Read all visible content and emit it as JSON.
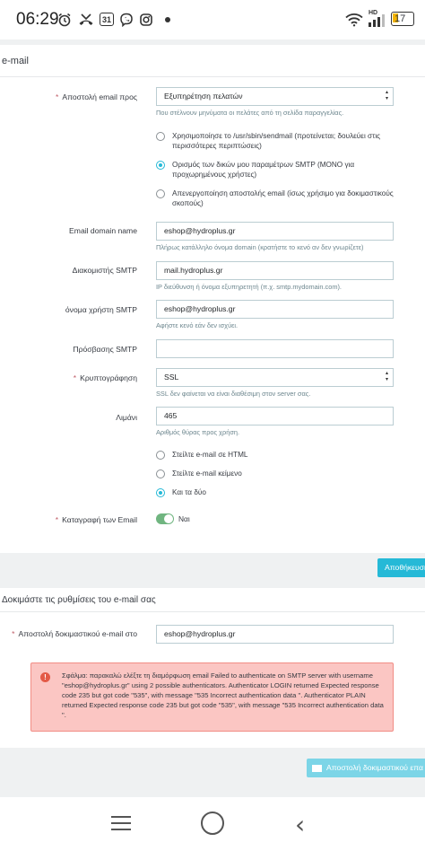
{
  "status_bar": {
    "time": "06:29",
    "icons": [
      "alarm-icon",
      "missed-call-icon",
      "calendar-icon",
      "viber-icon",
      "instagram-icon",
      "dot-icon",
      "wifi-icon",
      "signal-icon",
      "battery-icon"
    ],
    "calendar_day": "31",
    "network": "HD",
    "battery": "17"
  },
  "email_section": {
    "title": "e-mail",
    "send_to": {
      "label": "Αποστολή email προς",
      "value": "Εξυπηρέτηση πελατών",
      "help": "Που στέλνουν μηνύματα οι πελάτες από τη σελίδα παραγγελίας."
    },
    "transport_options": [
      {
        "label": "Χρησιμοποίησε το /usr/sbin/sendmail (προτείνεται; δουλεύει στις περισσότερες περιπτώσεις)",
        "selected": false
      },
      {
        "label": "Ορισμός των δικών μου παραμέτρων SMTP (ΜΟΝΟ για προχωρημένους χρήστες)",
        "selected": true
      },
      {
        "label": "Απενεργοποίηση αποστολής email (ίσως χρήσιμο για δοκιμαστικούς σκοπούς)",
        "selected": false
      }
    ],
    "domain": {
      "label": "Email domain name",
      "value": "eshop@hydroplus.gr",
      "help": "Πλήρως κατάλληλο όνομα domain (κρατήστε το κενό αν δεν γνωρίζετε)"
    },
    "smtp_server": {
      "label": "Διακομιστής SMTP",
      "value": "mail.hydroplus.gr",
      "help": "IP διεύθυνση ή όνομα εξυπηρετητή (π.χ. smtp.mydomain.com)."
    },
    "smtp_user": {
      "label": "όνομα χρήστη SMTP",
      "value": "eshop@hydroplus.gr",
      "help": "Αφήστε κενό εάν δεν ισχύει."
    },
    "smtp_password": {
      "label": "Πρόσβασης SMTP",
      "value": ""
    },
    "encryption": {
      "label": "Κρυπτογράφηση",
      "value": "SSL",
      "help": "SSL δεν φαίνεται να είναι διαθέσιμη στον server σας."
    },
    "port": {
      "label": "Λιμάνι",
      "value": "465",
      "help": "Αριθμός θύρας προς χρήση."
    },
    "format_options": [
      {
        "label": "Στείλτε e-mail σε HTML",
        "selected": false
      },
      {
        "label": "Στείλτε e-mail κείμενο",
        "selected": false
      },
      {
        "label": "Και τα δύο",
        "selected": true
      }
    ],
    "log": {
      "label": "Καταγραφή των Email",
      "value": "Ναι",
      "enabled": true
    },
    "save_button": "Αποθήκευση"
  },
  "test_section": {
    "title": "Δοκιμάστε τις ρυθμίσεις του e-mail σας",
    "send_test": {
      "label": "Αποστολή δοκιμαστικού e-mail στο",
      "value": "eshop@hydroplus.gr"
    },
    "error": "Σφάλμα: παρακαλώ ελέξτε τη διαμόρφωση email Failed to authenticate on SMTP server with username \"eshop@hydroplus.gr\" using 2 possible authenticators. Authenticator LOGIN returned Expected response code 235 but got code \"535\", with message \"535 Incorrect authentication data \". Authenticator PLAIN returned Expected response code 235 but got code \"535\", with message \"535 Incorrect authentication data \".",
    "send_button": "Αποστολή δοκιμαστικού επα"
  },
  "colors": {
    "accent": "#25b9d7",
    "error_bg": "#fbc6c3",
    "error_border": "#f18d85",
    "toggle_on": "#70b580",
    "required": "#c05c67"
  }
}
